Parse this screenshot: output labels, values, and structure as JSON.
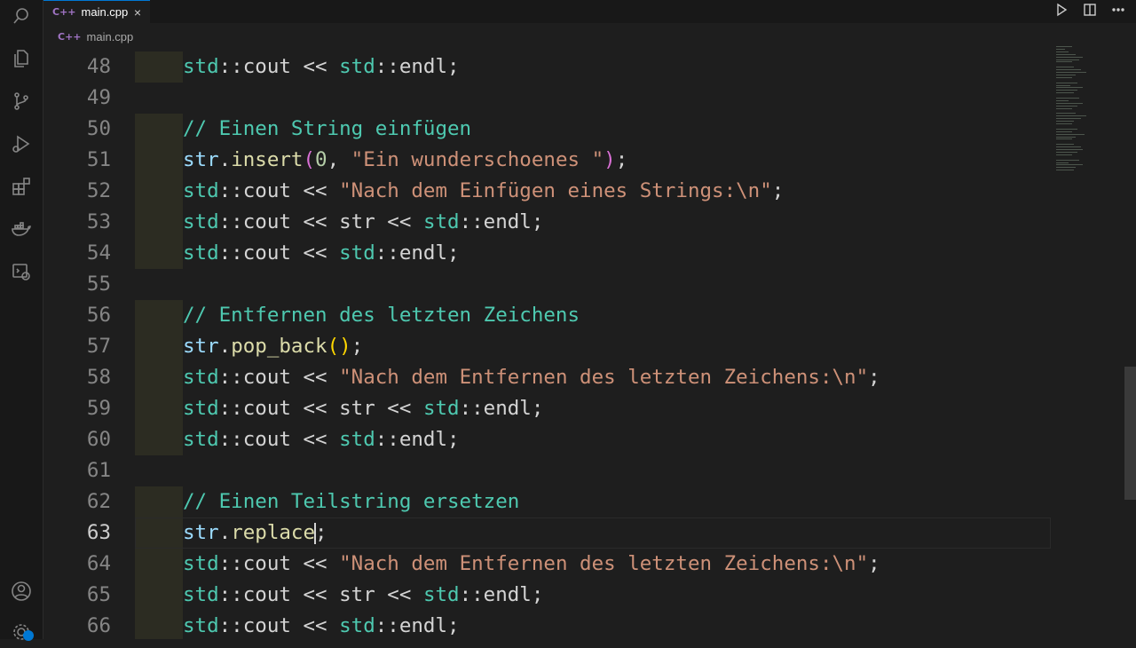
{
  "tab": {
    "file_name": "main.cpp",
    "icon": "C++ file icon",
    "close": "×"
  },
  "breadcrumb": {
    "file_name": "main.cpp"
  },
  "colors": {
    "comment": "#4ec9b0",
    "string": "#ce9178",
    "namespace": "#4ec9b0",
    "function": "#dcdcaa",
    "number": "#b5cea8",
    "accent": "#0078d4"
  },
  "editor": {
    "active_line": "63",
    "lines": [
      {
        "n": "48",
        "t": [
          [
            "ns",
            "std"
          ],
          [
            "p",
            "::cout << "
          ],
          [
            "ns",
            "std"
          ],
          [
            "p",
            "::endl;"
          ]
        ]
      },
      {
        "n": "49",
        "t": []
      },
      {
        "n": "50",
        "t": [
          [
            "com",
            "// Einen String einfügen"
          ]
        ]
      },
      {
        "n": "51",
        "t": [
          [
            "var",
            "str"
          ],
          [
            "p",
            "."
          ],
          [
            "fn",
            "insert"
          ],
          [
            "p1",
            "("
          ],
          [
            "num",
            "0"
          ],
          [
            "p",
            ", "
          ],
          [
            "str",
            "\"Ein wunderschoenes \""
          ],
          [
            "p1",
            ")"
          ],
          [
            "p",
            ";"
          ]
        ]
      },
      {
        "n": "52",
        "t": [
          [
            "ns",
            "std"
          ],
          [
            "p",
            "::cout << "
          ],
          [
            "str",
            "\"Nach dem Einfügen eines Strings:\\n\""
          ],
          [
            "p",
            ";"
          ]
        ]
      },
      {
        "n": "53",
        "t": [
          [
            "ns",
            "std"
          ],
          [
            "p",
            "::cout << str << "
          ],
          [
            "ns",
            "std"
          ],
          [
            "p",
            "::endl;"
          ]
        ]
      },
      {
        "n": "54",
        "t": [
          [
            "ns",
            "std"
          ],
          [
            "p",
            "::cout << "
          ],
          [
            "ns",
            "std"
          ],
          [
            "p",
            "::endl;"
          ]
        ]
      },
      {
        "n": "55",
        "t": []
      },
      {
        "n": "56",
        "t": [
          [
            "com",
            "// Entfernen des letzten Zeichens"
          ]
        ]
      },
      {
        "n": "57",
        "t": [
          [
            "var",
            "str"
          ],
          [
            "p",
            "."
          ],
          [
            "fn",
            "pop_back"
          ],
          [
            "p2",
            "()"
          ],
          [
            "p",
            ";"
          ]
        ]
      },
      {
        "n": "58",
        "t": [
          [
            "ns",
            "std"
          ],
          [
            "p",
            "::cout << "
          ],
          [
            "str",
            "\"Nach dem Entfernen des letzten Zeichens:\\n\""
          ],
          [
            "p",
            ";"
          ]
        ]
      },
      {
        "n": "59",
        "t": [
          [
            "ns",
            "std"
          ],
          [
            "p",
            "::cout << str << "
          ],
          [
            "ns",
            "std"
          ],
          [
            "p",
            "::endl;"
          ]
        ]
      },
      {
        "n": "60",
        "t": [
          [
            "ns",
            "std"
          ],
          [
            "p",
            "::cout << "
          ],
          [
            "ns",
            "std"
          ],
          [
            "p",
            "::endl;"
          ]
        ]
      },
      {
        "n": "61",
        "t": []
      },
      {
        "n": "62",
        "t": [
          [
            "com",
            "// Einen Teilstring ersetzen"
          ]
        ]
      },
      {
        "n": "63",
        "t": [
          [
            "var",
            "str"
          ],
          [
            "p",
            "."
          ],
          [
            "fn",
            "replace"
          ],
          [
            "cursor",
            ""
          ],
          [
            "p",
            ";"
          ]
        ]
      },
      {
        "n": "64",
        "t": [
          [
            "ns",
            "std"
          ],
          [
            "p",
            "::cout << "
          ],
          [
            "str",
            "\"Nach dem Entfernen des letzten Zeichens:\\n\""
          ],
          [
            "p",
            ";"
          ]
        ]
      },
      {
        "n": "65",
        "t": [
          [
            "ns",
            "std"
          ],
          [
            "p",
            "::cout << str << "
          ],
          [
            "ns",
            "std"
          ],
          [
            "p",
            "::endl;"
          ]
        ]
      },
      {
        "n": "66",
        "t": [
          [
            "ns",
            "std"
          ],
          [
            "p",
            "::cout << "
          ],
          [
            "ns",
            "std"
          ],
          [
            "p",
            "::endl;"
          ]
        ]
      }
    ]
  }
}
